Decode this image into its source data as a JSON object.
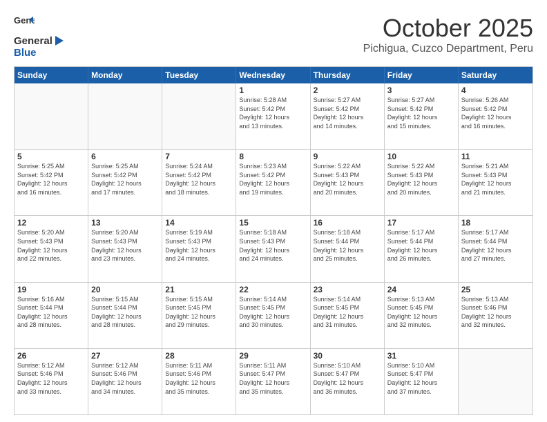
{
  "logo": {
    "general": "General",
    "blue": "Blue"
  },
  "title": "October 2025",
  "location": "Pichigua, Cuzco Department, Peru",
  "days_of_week": [
    "Sunday",
    "Monday",
    "Tuesday",
    "Wednesday",
    "Thursday",
    "Friday",
    "Saturday"
  ],
  "weeks": [
    [
      {
        "day": "",
        "info": ""
      },
      {
        "day": "",
        "info": ""
      },
      {
        "day": "",
        "info": ""
      },
      {
        "day": "1",
        "info": "Sunrise: 5:28 AM\nSunset: 5:42 PM\nDaylight: 12 hours\nand 13 minutes."
      },
      {
        "day": "2",
        "info": "Sunrise: 5:27 AM\nSunset: 5:42 PM\nDaylight: 12 hours\nand 14 minutes."
      },
      {
        "day": "3",
        "info": "Sunrise: 5:27 AM\nSunset: 5:42 PM\nDaylight: 12 hours\nand 15 minutes."
      },
      {
        "day": "4",
        "info": "Sunrise: 5:26 AM\nSunset: 5:42 PM\nDaylight: 12 hours\nand 16 minutes."
      }
    ],
    [
      {
        "day": "5",
        "info": "Sunrise: 5:25 AM\nSunset: 5:42 PM\nDaylight: 12 hours\nand 16 minutes."
      },
      {
        "day": "6",
        "info": "Sunrise: 5:25 AM\nSunset: 5:42 PM\nDaylight: 12 hours\nand 17 minutes."
      },
      {
        "day": "7",
        "info": "Sunrise: 5:24 AM\nSunset: 5:42 PM\nDaylight: 12 hours\nand 18 minutes."
      },
      {
        "day": "8",
        "info": "Sunrise: 5:23 AM\nSunset: 5:42 PM\nDaylight: 12 hours\nand 19 minutes."
      },
      {
        "day": "9",
        "info": "Sunrise: 5:22 AM\nSunset: 5:43 PM\nDaylight: 12 hours\nand 20 minutes."
      },
      {
        "day": "10",
        "info": "Sunrise: 5:22 AM\nSunset: 5:43 PM\nDaylight: 12 hours\nand 20 minutes."
      },
      {
        "day": "11",
        "info": "Sunrise: 5:21 AM\nSunset: 5:43 PM\nDaylight: 12 hours\nand 21 minutes."
      }
    ],
    [
      {
        "day": "12",
        "info": "Sunrise: 5:20 AM\nSunset: 5:43 PM\nDaylight: 12 hours\nand 22 minutes."
      },
      {
        "day": "13",
        "info": "Sunrise: 5:20 AM\nSunset: 5:43 PM\nDaylight: 12 hours\nand 23 minutes."
      },
      {
        "day": "14",
        "info": "Sunrise: 5:19 AM\nSunset: 5:43 PM\nDaylight: 12 hours\nand 24 minutes."
      },
      {
        "day": "15",
        "info": "Sunrise: 5:18 AM\nSunset: 5:43 PM\nDaylight: 12 hours\nand 24 minutes."
      },
      {
        "day": "16",
        "info": "Sunrise: 5:18 AM\nSunset: 5:44 PM\nDaylight: 12 hours\nand 25 minutes."
      },
      {
        "day": "17",
        "info": "Sunrise: 5:17 AM\nSunset: 5:44 PM\nDaylight: 12 hours\nand 26 minutes."
      },
      {
        "day": "18",
        "info": "Sunrise: 5:17 AM\nSunset: 5:44 PM\nDaylight: 12 hours\nand 27 minutes."
      }
    ],
    [
      {
        "day": "19",
        "info": "Sunrise: 5:16 AM\nSunset: 5:44 PM\nDaylight: 12 hours\nand 28 minutes."
      },
      {
        "day": "20",
        "info": "Sunrise: 5:15 AM\nSunset: 5:44 PM\nDaylight: 12 hours\nand 28 minutes."
      },
      {
        "day": "21",
        "info": "Sunrise: 5:15 AM\nSunset: 5:45 PM\nDaylight: 12 hours\nand 29 minutes."
      },
      {
        "day": "22",
        "info": "Sunrise: 5:14 AM\nSunset: 5:45 PM\nDaylight: 12 hours\nand 30 minutes."
      },
      {
        "day": "23",
        "info": "Sunrise: 5:14 AM\nSunset: 5:45 PM\nDaylight: 12 hours\nand 31 minutes."
      },
      {
        "day": "24",
        "info": "Sunrise: 5:13 AM\nSunset: 5:45 PM\nDaylight: 12 hours\nand 32 minutes."
      },
      {
        "day": "25",
        "info": "Sunrise: 5:13 AM\nSunset: 5:46 PM\nDaylight: 12 hours\nand 32 minutes."
      }
    ],
    [
      {
        "day": "26",
        "info": "Sunrise: 5:12 AM\nSunset: 5:46 PM\nDaylight: 12 hours\nand 33 minutes."
      },
      {
        "day": "27",
        "info": "Sunrise: 5:12 AM\nSunset: 5:46 PM\nDaylight: 12 hours\nand 34 minutes."
      },
      {
        "day": "28",
        "info": "Sunrise: 5:11 AM\nSunset: 5:46 PM\nDaylight: 12 hours\nand 35 minutes."
      },
      {
        "day": "29",
        "info": "Sunrise: 5:11 AM\nSunset: 5:47 PM\nDaylight: 12 hours\nand 35 minutes."
      },
      {
        "day": "30",
        "info": "Sunrise: 5:10 AM\nSunset: 5:47 PM\nDaylight: 12 hours\nand 36 minutes."
      },
      {
        "day": "31",
        "info": "Sunrise: 5:10 AM\nSunset: 5:47 PM\nDaylight: 12 hours\nand 37 minutes."
      },
      {
        "day": "",
        "info": ""
      }
    ]
  ]
}
